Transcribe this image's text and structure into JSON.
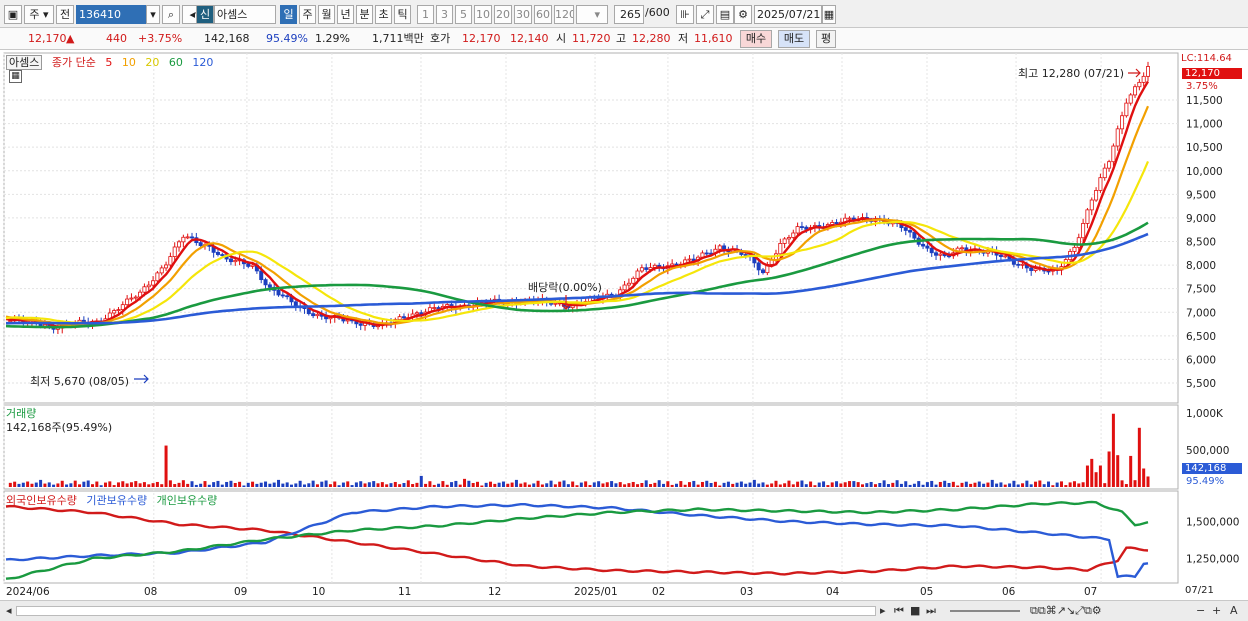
{
  "toolbar": {
    "period": "주",
    "prefix": "전",
    "code": "136410",
    "credit_badge": "신",
    "name": "아셈스",
    "periods": [
      "일",
      "주",
      "월",
      "년",
      "분",
      "초",
      "틱"
    ],
    "intervals": [
      "1",
      "3",
      "5",
      "10",
      "20",
      "30",
      "60",
      "120"
    ],
    "count": "265",
    "count_total": "/600",
    "date": "2025/07/21"
  },
  "quote": {
    "price": "12,170",
    "arrow": "▲",
    "change": "440",
    "change_pct": "+3.75%",
    "volume": "142,168",
    "volume_pct": "95.49%",
    "turnover_pct": "1.29%",
    "amount": "1,711백만",
    "ask_label": "호가",
    "ask": "12,170",
    "bid": "12,140",
    "open_label": "시",
    "open": "11,720",
    "high_label": "고",
    "high": "12,280",
    "low_label": "저",
    "low": "11,610",
    "buy_label": "매수",
    "sell_label": "매도",
    "avg_label": "평"
  },
  "price_pane": {
    "name_tag": "아셈스",
    "ma_title": "종가 단순",
    "ma_labels": [
      "5",
      "10",
      "20",
      "60",
      "120"
    ],
    "ma_colors": [
      "#e01010",
      "#f2a000",
      "#f5e60a",
      "#1a9a40",
      "#2b5bd6"
    ],
    "lc_label": "LC:114.64",
    "current_tag": "12,170",
    "current_pct": "3.75%",
    "high_note": "최고 12,280 (07/21)",
    "low_note": "최저 5,670 (08/05)",
    "dividend_note": "배당락(0.00%)",
    "y_ticks": [
      "11,500",
      "11,000",
      "10,500",
      "10,000",
      "9,500",
      "9,000",
      "8,500",
      "8,000",
      "7,500",
      "7,000",
      "6,500",
      "6,000",
      "5,500"
    ]
  },
  "volume_pane": {
    "title": "거래량",
    "reading": "142,168주(95.49%)",
    "y_ticks": [
      "1,000K",
      "500,000"
    ],
    "current_tag": "142,168",
    "current_pct": "95.49%"
  },
  "holding_pane": {
    "series": [
      {
        "name": "외국인보유수량",
        "color": "#d11a1a"
      },
      {
        "name": "기관보유수량",
        "color": "#2b5bd6"
      },
      {
        "name": "개인보유수량",
        "color": "#1a9a40"
      }
    ],
    "y_ticks": [
      "1,500,000",
      "1,250,000"
    ]
  },
  "x_axis": {
    "labels": [
      "2024/06",
      "08",
      "09",
      "10",
      "11",
      "12",
      "2025/01",
      "02",
      "03",
      "04",
      "05",
      "06",
      "07"
    ],
    "last_label": "07/21"
  },
  "chart_data": [
    {
      "type": "line",
      "title": "",
      "series": [
        {
          "name": "5",
          "color": "#e01010"
        },
        {
          "name": "10",
          "color": "#f2a000"
        },
        {
          "name": "20",
          "color": "#f5e60a"
        },
        {
          "name": "60",
          "color": "#1a9a40"
        },
        {
          "name": "120",
          "color": "#2b5bd6"
        }
      ],
      "price_range": [
        5500,
        12300
      ],
      "high": {
        "value": 12280,
        "date": "07/21"
      },
      "low": {
        "value": 5670,
        "date": "08/05"
      },
      "last_close": 12170
    },
    {
      "type": "bar",
      "title": "거래량",
      "last_value": 142168,
      "ylim": [
        0,
        1000000
      ]
    },
    {
      "type": "line",
      "series": [
        {
          "name": "외국인보유수량"
        },
        {
          "name": "기관보유수량"
        },
        {
          "name": "개인보유수량"
        }
      ],
      "ylim": [
        1100000,
        1650000
      ]
    }
  ]
}
